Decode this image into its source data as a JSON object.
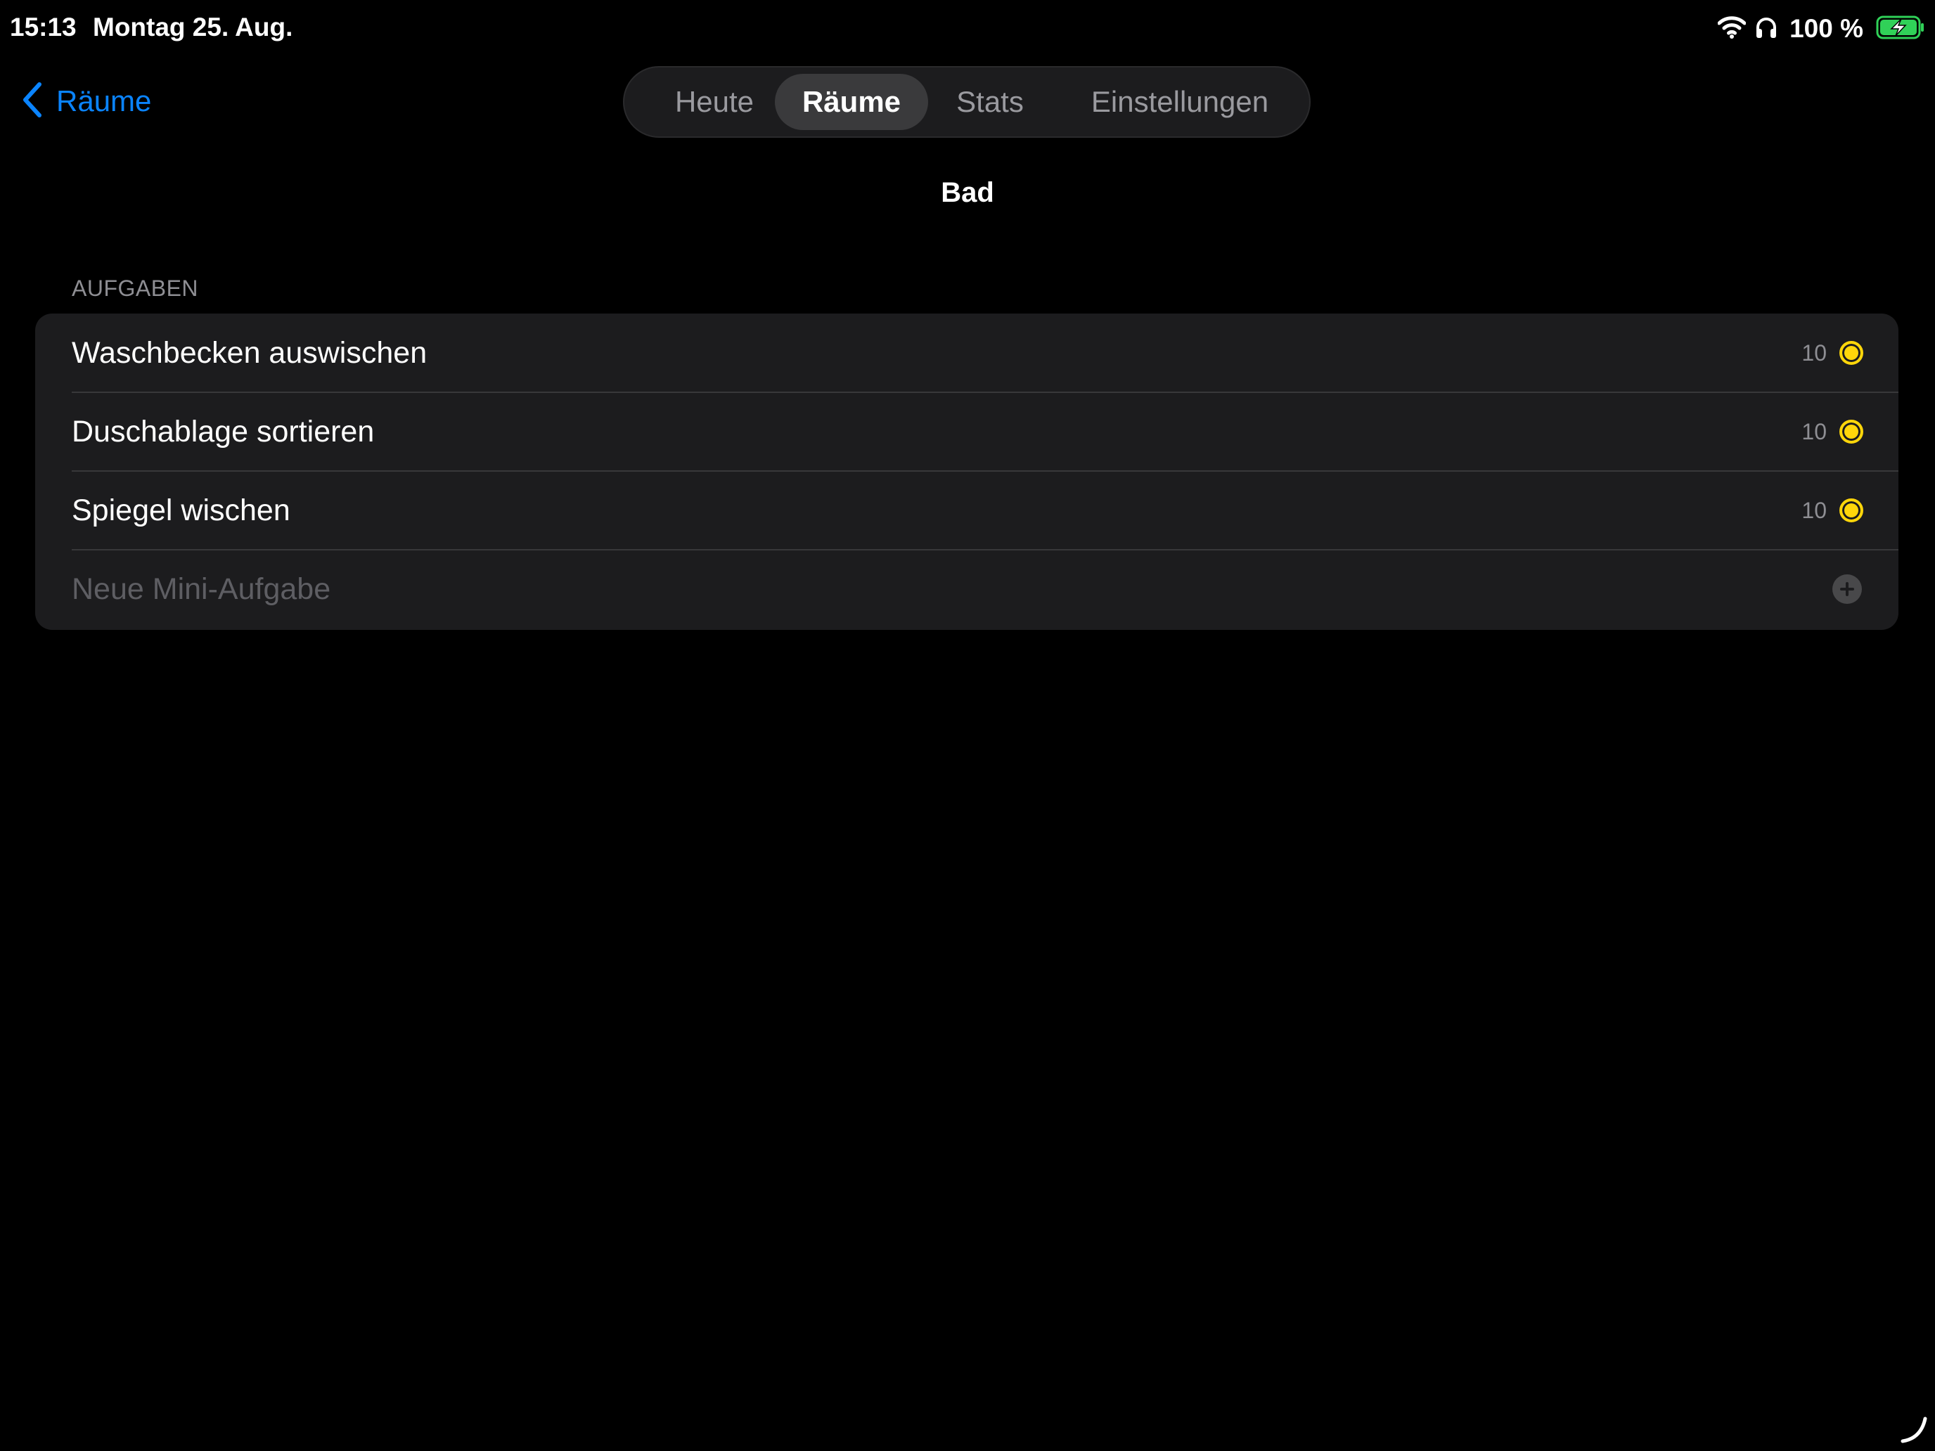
{
  "status_bar": {
    "time": "15:13",
    "date": "Montag 25. Aug.",
    "battery_percent": "100 %",
    "icons": [
      "wifi-icon",
      "headphones-icon",
      "battery-charging-icon"
    ]
  },
  "nav": {
    "back_label": "Räume"
  },
  "tabs": [
    {
      "label": "Heute",
      "active": false
    },
    {
      "label": "Räume",
      "active": true
    },
    {
      "label": "Stats",
      "active": false
    },
    {
      "label": "Einstellungen",
      "active": false
    }
  ],
  "page_title": "Bad",
  "section": {
    "header": "AUFGABEN",
    "tasks": [
      {
        "label": "Waschbecken auswischen",
        "points": "10"
      },
      {
        "label": "Duschablage sortieren",
        "points": "10"
      },
      {
        "label": "Spiegel wischen",
        "points": "10"
      }
    ],
    "new_task_placeholder": "Neue Mini-Aufgabe"
  },
  "colors": {
    "accent": "#0a84ff",
    "coin": "#ffd60a",
    "card_background": "#1c1c1e",
    "battery": "#30d158"
  }
}
